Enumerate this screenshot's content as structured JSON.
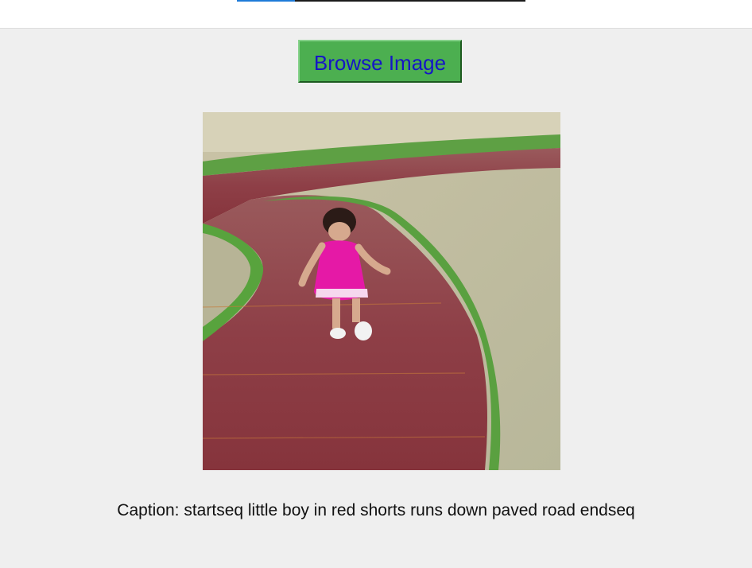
{
  "progress": {
    "fraction": 0.2
  },
  "toolbar": {
    "browse_label": "Browse Image"
  },
  "preview": {
    "icon": "photo-child-walking-on-path"
  },
  "caption": {
    "text": "Caption: startseq little boy in red shorts runs down paved road endseq"
  },
  "colors": {
    "button_bg": "#4caf50",
    "button_text": "#1515c7",
    "window_bg": "#efefef",
    "progress_fill": "#1e7bd8"
  }
}
